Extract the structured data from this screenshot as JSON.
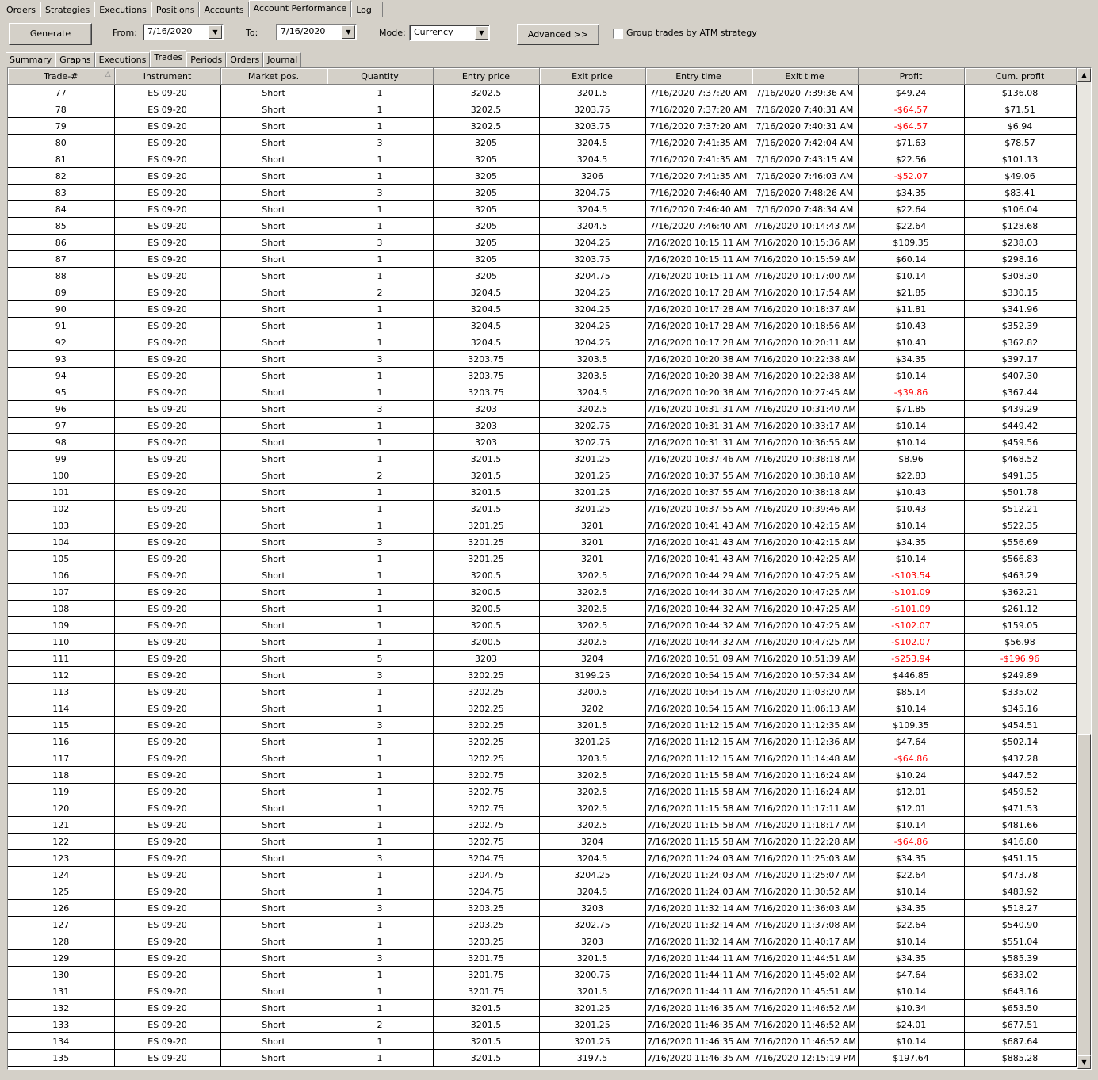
{
  "main_tabs": [
    "Orders",
    "Strategies",
    "Executions",
    "Positions",
    "Accounts",
    "Account Performance",
    "Log"
  ],
  "active_main_tab": 5,
  "toolbar": {
    "generate_label": "Generate",
    "from_label": "From:",
    "from_value": "7/16/2020",
    "to_label": "To:",
    "to_value": "7/16/2020",
    "mode_label": "Mode:",
    "mode_value": "Currency",
    "advanced_label": "Advanced >>",
    "group_label": "Group trades by ATM strategy"
  },
  "sub_tabs": [
    "Summary",
    "Graphs",
    "Executions",
    "Trades",
    "Periods",
    "Orders",
    "Journal"
  ],
  "active_sub_tab": 3,
  "columns": [
    "Trade-#",
    "Instrument",
    "Market pos.",
    "Quantity",
    "Entry price",
    "Exit price",
    "Entry time",
    "Exit time",
    "Profit",
    "Cum. profit"
  ],
  "rows": [
    [
      "77",
      "ES 09-20",
      "Short",
      "1",
      "3202.5",
      "3201.5",
      "7/16/2020 7:37:20 AM",
      "7/16/2020 7:39:36 AM",
      "$49.24",
      "$136.08"
    ],
    [
      "78",
      "ES 09-20",
      "Short",
      "1",
      "3202.5",
      "3203.75",
      "7/16/2020 7:37:20 AM",
      "7/16/2020 7:40:31 AM",
      "-$64.57",
      "$71.51"
    ],
    [
      "79",
      "ES 09-20",
      "Short",
      "1",
      "3202.5",
      "3203.75",
      "7/16/2020 7:37:20 AM",
      "7/16/2020 7:40:31 AM",
      "-$64.57",
      "$6.94"
    ],
    [
      "80",
      "ES 09-20",
      "Short",
      "3",
      "3205",
      "3204.5",
      "7/16/2020 7:41:35 AM",
      "7/16/2020 7:42:04 AM",
      "$71.63",
      "$78.57"
    ],
    [
      "81",
      "ES 09-20",
      "Short",
      "1",
      "3205",
      "3204.5",
      "7/16/2020 7:41:35 AM",
      "7/16/2020 7:43:15 AM",
      "$22.56",
      "$101.13"
    ],
    [
      "82",
      "ES 09-20",
      "Short",
      "1",
      "3205",
      "3206",
      "7/16/2020 7:41:35 AM",
      "7/16/2020 7:46:03 AM",
      "-$52.07",
      "$49.06"
    ],
    [
      "83",
      "ES 09-20",
      "Short",
      "3",
      "3205",
      "3204.75",
      "7/16/2020 7:46:40 AM",
      "7/16/2020 7:48:26 AM",
      "$34.35",
      "$83.41"
    ],
    [
      "84",
      "ES 09-20",
      "Short",
      "1",
      "3205",
      "3204.5",
      "7/16/2020 7:46:40 AM",
      "7/16/2020 7:48:34 AM",
      "$22.64",
      "$106.04"
    ],
    [
      "85",
      "ES 09-20",
      "Short",
      "1",
      "3205",
      "3204.5",
      "7/16/2020 7:46:40 AM",
      "7/16/2020 10:14:43 AM",
      "$22.64",
      "$128.68"
    ],
    [
      "86",
      "ES 09-20",
      "Short",
      "3",
      "3205",
      "3204.25",
      "7/16/2020 10:15:11 AM",
      "7/16/2020 10:15:36 AM",
      "$109.35",
      "$238.03"
    ],
    [
      "87",
      "ES 09-20",
      "Short",
      "1",
      "3205",
      "3203.75",
      "7/16/2020 10:15:11 AM",
      "7/16/2020 10:15:59 AM",
      "$60.14",
      "$298.16"
    ],
    [
      "88",
      "ES 09-20",
      "Short",
      "1",
      "3205",
      "3204.75",
      "7/16/2020 10:15:11 AM",
      "7/16/2020 10:17:00 AM",
      "$10.14",
      "$308.30"
    ],
    [
      "89",
      "ES 09-20",
      "Short",
      "2",
      "3204.5",
      "3204.25",
      "7/16/2020 10:17:28 AM",
      "7/16/2020 10:17:54 AM",
      "$21.85",
      "$330.15"
    ],
    [
      "90",
      "ES 09-20",
      "Short",
      "1",
      "3204.5",
      "3204.25",
      "7/16/2020 10:17:28 AM",
      "7/16/2020 10:18:37 AM",
      "$11.81",
      "$341.96"
    ],
    [
      "91",
      "ES 09-20",
      "Short",
      "1",
      "3204.5",
      "3204.25",
      "7/16/2020 10:17:28 AM",
      "7/16/2020 10:18:56 AM",
      "$10.43",
      "$352.39"
    ],
    [
      "92",
      "ES 09-20",
      "Short",
      "1",
      "3204.5",
      "3204.25",
      "7/16/2020 10:17:28 AM",
      "7/16/2020 10:20:11 AM",
      "$10.43",
      "$362.82"
    ],
    [
      "93",
      "ES 09-20",
      "Short",
      "3",
      "3203.75",
      "3203.5",
      "7/16/2020 10:20:38 AM",
      "7/16/2020 10:22:38 AM",
      "$34.35",
      "$397.17"
    ],
    [
      "94",
      "ES 09-20",
      "Short",
      "1",
      "3203.75",
      "3203.5",
      "7/16/2020 10:20:38 AM",
      "7/16/2020 10:22:38 AM",
      "$10.14",
      "$407.30"
    ],
    [
      "95",
      "ES 09-20",
      "Short",
      "1",
      "3203.75",
      "3204.5",
      "7/16/2020 10:20:38 AM",
      "7/16/2020 10:27:45 AM",
      "-$39.86",
      "$367.44"
    ],
    [
      "96",
      "ES 09-20",
      "Short",
      "3",
      "3203",
      "3202.5",
      "7/16/2020 10:31:31 AM",
      "7/16/2020 10:31:40 AM",
      "$71.85",
      "$439.29"
    ],
    [
      "97",
      "ES 09-20",
      "Short",
      "1",
      "3203",
      "3202.75",
      "7/16/2020 10:31:31 AM",
      "7/16/2020 10:33:17 AM",
      "$10.14",
      "$449.42"
    ],
    [
      "98",
      "ES 09-20",
      "Short",
      "1",
      "3203",
      "3202.75",
      "7/16/2020 10:31:31 AM",
      "7/16/2020 10:36:55 AM",
      "$10.14",
      "$459.56"
    ],
    [
      "99",
      "ES 09-20",
      "Short",
      "1",
      "3201.5",
      "3201.25",
      "7/16/2020 10:37:46 AM",
      "7/16/2020 10:38:18 AM",
      "$8.96",
      "$468.52"
    ],
    [
      "100",
      "ES 09-20",
      "Short",
      "2",
      "3201.5",
      "3201.25",
      "7/16/2020 10:37:55 AM",
      "7/16/2020 10:38:18 AM",
      "$22.83",
      "$491.35"
    ],
    [
      "101",
      "ES 09-20",
      "Short",
      "1",
      "3201.5",
      "3201.25",
      "7/16/2020 10:37:55 AM",
      "7/16/2020 10:38:18 AM",
      "$10.43",
      "$501.78"
    ],
    [
      "102",
      "ES 09-20",
      "Short",
      "1",
      "3201.5",
      "3201.25",
      "7/16/2020 10:37:55 AM",
      "7/16/2020 10:39:46 AM",
      "$10.43",
      "$512.21"
    ],
    [
      "103",
      "ES 09-20",
      "Short",
      "1",
      "3201.25",
      "3201",
      "7/16/2020 10:41:43 AM",
      "7/16/2020 10:42:15 AM",
      "$10.14",
      "$522.35"
    ],
    [
      "104",
      "ES 09-20",
      "Short",
      "3",
      "3201.25",
      "3201",
      "7/16/2020 10:41:43 AM",
      "7/16/2020 10:42:15 AM",
      "$34.35",
      "$556.69"
    ],
    [
      "105",
      "ES 09-20",
      "Short",
      "1",
      "3201.25",
      "3201",
      "7/16/2020 10:41:43 AM",
      "7/16/2020 10:42:25 AM",
      "$10.14",
      "$566.83"
    ],
    [
      "106",
      "ES 09-20",
      "Short",
      "1",
      "3200.5",
      "3202.5",
      "7/16/2020 10:44:29 AM",
      "7/16/2020 10:47:25 AM",
      "-$103.54",
      "$463.29"
    ],
    [
      "107",
      "ES 09-20",
      "Short",
      "1",
      "3200.5",
      "3202.5",
      "7/16/2020 10:44:30 AM",
      "7/16/2020 10:47:25 AM",
      "-$101.09",
      "$362.21"
    ],
    [
      "108",
      "ES 09-20",
      "Short",
      "1",
      "3200.5",
      "3202.5",
      "7/16/2020 10:44:32 AM",
      "7/16/2020 10:47:25 AM",
      "-$101.09",
      "$261.12"
    ],
    [
      "109",
      "ES 09-20",
      "Short",
      "1",
      "3200.5",
      "3202.5",
      "7/16/2020 10:44:32 AM",
      "7/16/2020 10:47:25 AM",
      "-$102.07",
      "$159.05"
    ],
    [
      "110",
      "ES 09-20",
      "Short",
      "1",
      "3200.5",
      "3202.5",
      "7/16/2020 10:44:32 AM",
      "7/16/2020 10:47:25 AM",
      "-$102.07",
      "$56.98"
    ],
    [
      "111",
      "ES 09-20",
      "Short",
      "5",
      "3203",
      "3204",
      "7/16/2020 10:51:09 AM",
      "7/16/2020 10:51:39 AM",
      "-$253.94",
      "-$196.96"
    ],
    [
      "112",
      "ES 09-20",
      "Short",
      "3",
      "3202.25",
      "3199.25",
      "7/16/2020 10:54:15 AM",
      "7/16/2020 10:57:34 AM",
      "$446.85",
      "$249.89"
    ],
    [
      "113",
      "ES 09-20",
      "Short",
      "1",
      "3202.25",
      "3200.5",
      "7/16/2020 10:54:15 AM",
      "7/16/2020 11:03:20 AM",
      "$85.14",
      "$335.02"
    ],
    [
      "114",
      "ES 09-20",
      "Short",
      "1",
      "3202.25",
      "3202",
      "7/16/2020 10:54:15 AM",
      "7/16/2020 11:06:13 AM",
      "$10.14",
      "$345.16"
    ],
    [
      "115",
      "ES 09-20",
      "Short",
      "3",
      "3202.25",
      "3201.5",
      "7/16/2020 11:12:15 AM",
      "7/16/2020 11:12:35 AM",
      "$109.35",
      "$454.51"
    ],
    [
      "116",
      "ES 09-20",
      "Short",
      "1",
      "3202.25",
      "3201.25",
      "7/16/2020 11:12:15 AM",
      "7/16/2020 11:12:36 AM",
      "$47.64",
      "$502.14"
    ],
    [
      "117",
      "ES 09-20",
      "Short",
      "1",
      "3202.25",
      "3203.5",
      "7/16/2020 11:12:15 AM",
      "7/16/2020 11:14:48 AM",
      "-$64.86",
      "$437.28"
    ],
    [
      "118",
      "ES 09-20",
      "Short",
      "1",
      "3202.75",
      "3202.5",
      "7/16/2020 11:15:58 AM",
      "7/16/2020 11:16:24 AM",
      "$10.24",
      "$447.52"
    ],
    [
      "119",
      "ES 09-20",
      "Short",
      "1",
      "3202.75",
      "3202.5",
      "7/16/2020 11:15:58 AM",
      "7/16/2020 11:16:24 AM",
      "$12.01",
      "$459.52"
    ],
    [
      "120",
      "ES 09-20",
      "Short",
      "1",
      "3202.75",
      "3202.5",
      "7/16/2020 11:15:58 AM",
      "7/16/2020 11:17:11 AM",
      "$12.01",
      "$471.53"
    ],
    [
      "121",
      "ES 09-20",
      "Short",
      "1",
      "3202.75",
      "3202.5",
      "7/16/2020 11:15:58 AM",
      "7/16/2020 11:18:17 AM",
      "$10.14",
      "$481.66"
    ],
    [
      "122",
      "ES 09-20",
      "Short",
      "1",
      "3202.75",
      "3204",
      "7/16/2020 11:15:58 AM",
      "7/16/2020 11:22:28 AM",
      "-$64.86",
      "$416.80"
    ],
    [
      "123",
      "ES 09-20",
      "Short",
      "3",
      "3204.75",
      "3204.5",
      "7/16/2020 11:24:03 AM",
      "7/16/2020 11:25:03 AM",
      "$34.35",
      "$451.15"
    ],
    [
      "124",
      "ES 09-20",
      "Short",
      "1",
      "3204.75",
      "3204.25",
      "7/16/2020 11:24:03 AM",
      "7/16/2020 11:25:07 AM",
      "$22.64",
      "$473.78"
    ],
    [
      "125",
      "ES 09-20",
      "Short",
      "1",
      "3204.75",
      "3204.5",
      "7/16/2020 11:24:03 AM",
      "7/16/2020 11:30:52 AM",
      "$10.14",
      "$483.92"
    ],
    [
      "126",
      "ES 09-20",
      "Short",
      "3",
      "3203.25",
      "3203",
      "7/16/2020 11:32:14 AM",
      "7/16/2020 11:36:03 AM",
      "$34.35",
      "$518.27"
    ],
    [
      "127",
      "ES 09-20",
      "Short",
      "1",
      "3203.25",
      "3202.75",
      "7/16/2020 11:32:14 AM",
      "7/16/2020 11:37:08 AM",
      "$22.64",
      "$540.90"
    ],
    [
      "128",
      "ES 09-20",
      "Short",
      "1",
      "3203.25",
      "3203",
      "7/16/2020 11:32:14 AM",
      "7/16/2020 11:40:17 AM",
      "$10.14",
      "$551.04"
    ],
    [
      "129",
      "ES 09-20",
      "Short",
      "3",
      "3201.75",
      "3201.5",
      "7/16/2020 11:44:11 AM",
      "7/16/2020 11:44:51 AM",
      "$34.35",
      "$585.39"
    ],
    [
      "130",
      "ES 09-20",
      "Short",
      "1",
      "3201.75",
      "3200.75",
      "7/16/2020 11:44:11 AM",
      "7/16/2020 11:45:02 AM",
      "$47.64",
      "$633.02"
    ],
    [
      "131",
      "ES 09-20",
      "Short",
      "1",
      "3201.75",
      "3201.5",
      "7/16/2020 11:44:11 AM",
      "7/16/2020 11:45:51 AM",
      "$10.14",
      "$643.16"
    ],
    [
      "132",
      "ES 09-20",
      "Short",
      "1",
      "3201.5",
      "3201.25",
      "7/16/2020 11:46:35 AM",
      "7/16/2020 11:46:52 AM",
      "$10.34",
      "$653.50"
    ],
    [
      "133",
      "ES 09-20",
      "Short",
      "2",
      "3201.5",
      "3201.25",
      "7/16/2020 11:46:35 AM",
      "7/16/2020 11:46:52 AM",
      "$24.01",
      "$677.51"
    ],
    [
      "134",
      "ES 09-20",
      "Short",
      "1",
      "3201.5",
      "3201.25",
      "7/16/2020 11:46:35 AM",
      "7/16/2020 11:46:52 AM",
      "$10.14",
      "$687.64"
    ],
    [
      "135",
      "ES 09-20",
      "Short",
      "1",
      "3201.5",
      "3197.5",
      "7/16/2020 11:46:35 AM",
      "7/16/2020 12:15:19 PM",
      "$197.64",
      "$885.28"
    ]
  ],
  "colors": {
    "negative": "#ff0000",
    "background": "#d4d0c8",
    "grid": "#000000"
  },
  "icons": {
    "sort": "sort-ascending-icon",
    "dropdown": "chevron-down-icon",
    "scroll_up": "scroll-up-icon",
    "scroll_down": "scroll-down-icon"
  }
}
